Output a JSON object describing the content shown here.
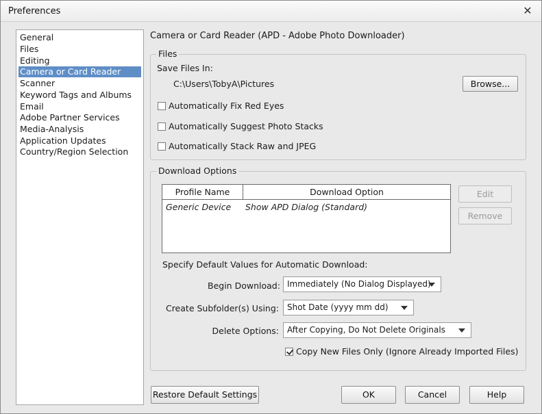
{
  "window": {
    "title": "Preferences",
    "close_glyph": "✕"
  },
  "sidebar": {
    "items": [
      {
        "label": "General",
        "selected": false
      },
      {
        "label": "Files",
        "selected": false
      },
      {
        "label": "Editing",
        "selected": false
      },
      {
        "label": "Camera or Card Reader",
        "selected": true
      },
      {
        "label": "Scanner",
        "selected": false
      },
      {
        "label": "Keyword Tags and Albums",
        "selected": false
      },
      {
        "label": "Email",
        "selected": false
      },
      {
        "label": "Adobe Partner Services",
        "selected": false
      },
      {
        "label": "Media-Analysis",
        "selected": false
      },
      {
        "label": "Application Updates",
        "selected": false
      },
      {
        "label": "Country/Region Selection",
        "selected": false
      }
    ]
  },
  "pane": {
    "title": "Camera or Card Reader (APD - Adobe Photo Downloader)",
    "files": {
      "legend": "Files",
      "save_label": "Save Files In:",
      "save_path": "C:\\Users\\TobyA\\Pictures",
      "browse_label": "Browse...",
      "checkboxes": [
        {
          "label": "Automatically Fix Red Eyes",
          "checked": false
        },
        {
          "label": "Automatically Suggest Photo Stacks",
          "checked": false
        },
        {
          "label": "Automatically Stack Raw and JPEG",
          "checked": false
        }
      ]
    },
    "download": {
      "legend": "Download Options",
      "table": {
        "columns": [
          "Profile Name",
          "Download Option"
        ],
        "rows": [
          [
            "Generic Device",
            "Show APD Dialog (Standard)"
          ]
        ]
      },
      "edit_label": "Edit",
      "remove_label": "Remove",
      "defaults_heading": "Specify Default Values for Automatic Download:",
      "begin_label": "Begin Download:",
      "begin_value": "Immediately (No Dialog Displayed)",
      "subfolder_label": "Create Subfolder(s) Using:",
      "subfolder_value": "Shot Date (yyyy mm dd)",
      "delete_label": "Delete Options:",
      "delete_value": "After Copying, Do Not Delete Originals",
      "copy_new_label": "Copy New Files Only (Ignore Already Imported Files)",
      "copy_new_checked": true
    }
  },
  "footer": {
    "restore_label": "Restore Default Settings",
    "ok_label": "OK",
    "cancel_label": "Cancel",
    "help_label": "Help"
  },
  "colors": {
    "selection": "#5f8ec7",
    "dialog_bg": "#e9e9e9"
  }
}
